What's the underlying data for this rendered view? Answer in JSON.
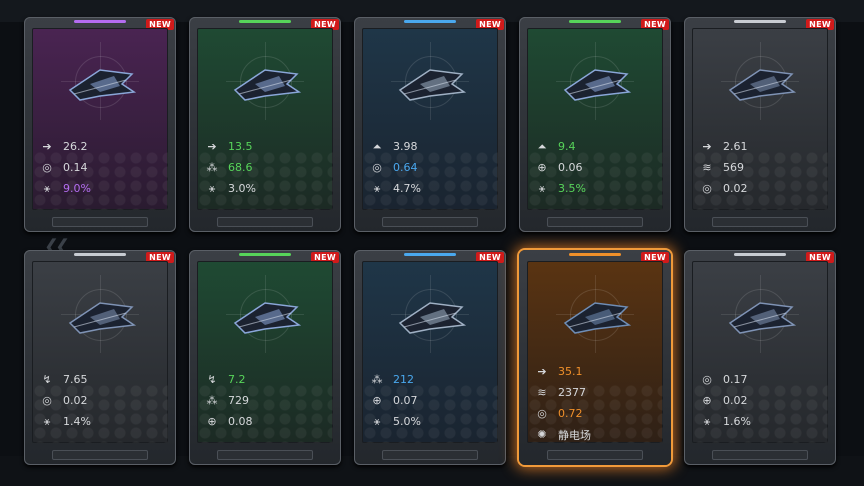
{
  "new_badge": "NEW",
  "cards": [
    {
      "rarity": "purple",
      "stats": [
        {
          "icon": "speed-icon",
          "value": "26.2",
          "color": ""
        },
        {
          "icon": "dodge-icon",
          "value": "0.14",
          "color": ""
        },
        {
          "icon": "crit-icon",
          "value": "9.0%",
          "color": "purple"
        }
      ]
    },
    {
      "rarity": "green",
      "stats": [
        {
          "icon": "speed-icon",
          "value": "13.5",
          "color": "green"
        },
        {
          "icon": "multishot-icon",
          "value": "68.6",
          "color": "green"
        },
        {
          "icon": "crit-icon",
          "value": "3.0%",
          "color": ""
        }
      ]
    },
    {
      "rarity": "blue",
      "stats": [
        {
          "icon": "missile-icon",
          "value": "3.98",
          "color": ""
        },
        {
          "icon": "dodge-icon",
          "value": "0.64",
          "color": "blue"
        },
        {
          "icon": "crit-icon",
          "value": "4.7%",
          "color": ""
        }
      ]
    },
    {
      "rarity": "green",
      "stats": [
        {
          "icon": "missile-icon",
          "value": "9.4",
          "color": "green"
        },
        {
          "icon": "target-icon",
          "value": "0.06",
          "color": ""
        },
        {
          "icon": "crit-icon",
          "value": "3.5%",
          "color": "green"
        }
      ]
    },
    {
      "rarity": "white",
      "stats": [
        {
          "icon": "speed-icon",
          "value": "2.61",
          "color": ""
        },
        {
          "icon": "armor-icon",
          "value": "569",
          "color": ""
        },
        {
          "icon": "dodge-icon",
          "value": "0.02",
          "color": ""
        }
      ]
    },
    {
      "rarity": "white",
      "stats": [
        {
          "icon": "boost-icon",
          "value": "7.65",
          "color": ""
        },
        {
          "icon": "dodge-icon",
          "value": "0.02",
          "color": ""
        },
        {
          "icon": "crit-icon",
          "value": "1.4%",
          "color": ""
        }
      ]
    },
    {
      "rarity": "green",
      "stats": [
        {
          "icon": "boost-icon",
          "value": "7.2",
          "color": "green"
        },
        {
          "icon": "multishot-icon",
          "value": "729",
          "color": ""
        },
        {
          "icon": "target-icon",
          "value": "0.08",
          "color": ""
        }
      ]
    },
    {
      "rarity": "blue",
      "stats": [
        {
          "icon": "multishot-icon",
          "value": "212",
          "color": "blue"
        },
        {
          "icon": "target-icon",
          "value": "0.07",
          "color": ""
        },
        {
          "icon": "crit-icon",
          "value": "5.0%",
          "color": ""
        }
      ]
    },
    {
      "rarity": "orange",
      "selected": true,
      "stats": [
        {
          "icon": "speed-icon",
          "value": "35.1",
          "color": "orange"
        },
        {
          "icon": "armor-icon",
          "value": "2377",
          "color": ""
        },
        {
          "icon": "dodge-icon",
          "value": "0.72",
          "color": "orange"
        },
        {
          "icon": "static-icon",
          "value": "静电场",
          "color": ""
        }
      ]
    },
    {
      "rarity": "white",
      "stats": [
        {
          "icon": "dodge-icon",
          "value": "0.17",
          "color": ""
        },
        {
          "icon": "target-icon",
          "value": "0.02",
          "color": ""
        },
        {
          "icon": "crit-icon",
          "value": "1.6%",
          "color": ""
        }
      ]
    }
  ],
  "colors": {
    "purple": "#b46cf0",
    "green": "#57d45a",
    "blue": "#4aa8ee",
    "orange": "#f0902a",
    "white": "#c8ccd2"
  }
}
